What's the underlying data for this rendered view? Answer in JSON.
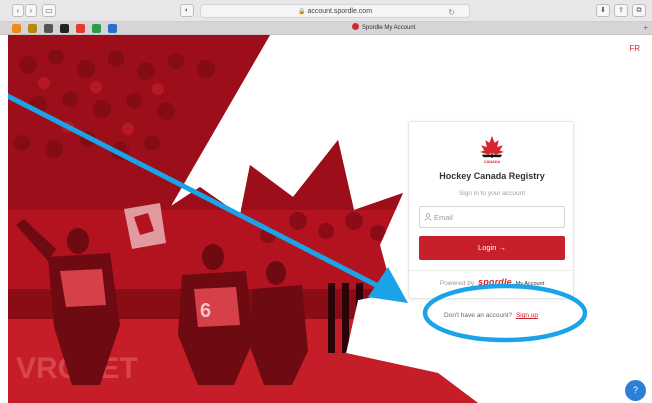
{
  "browser": {
    "url": "account.spordle.com",
    "tab_title": "Spordle My Account",
    "back_icon": "chevron-left-icon",
    "forward_icon": "chevron-right-icon",
    "sidebar_icon": "sidebar-icon"
  },
  "page": {
    "lang_toggle": "FR",
    "logo": {
      "name": "hockey-canada-logo",
      "text": "CANADA"
    },
    "title": "Hockey Canada Registry",
    "subtitle": "Sign in to your account",
    "email_placeholder": "Email",
    "login_label": "Login →",
    "powered_prefix": "Powered by",
    "powered_brand": "spordle",
    "powered_suffix": "My Account",
    "signup_prompt": "Don't have an account?",
    "signup_link": "Sign up",
    "help_label": "?"
  },
  "colors": {
    "brand_red": "#c8202b",
    "annotation_blue": "#1aa3e8",
    "help_blue": "#2d7fd6"
  }
}
